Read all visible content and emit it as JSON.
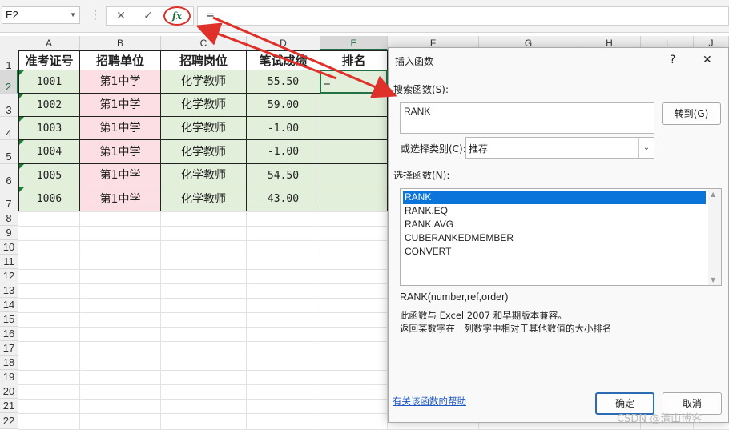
{
  "formula_bar": {
    "name_box": "E2",
    "separator": "⋮",
    "cancel_glyph": "✕",
    "enter_glyph": "✓",
    "fx_label": "fx",
    "formula": "="
  },
  "sheet": {
    "columns": [
      "A",
      "B",
      "C",
      "D",
      "E",
      "F",
      "G",
      "H",
      "I",
      "J"
    ],
    "rows": [
      "1",
      "2",
      "3",
      "4",
      "5",
      "6",
      "7",
      "8",
      "9",
      "10",
      "11",
      "12",
      "13",
      "14",
      "15",
      "16",
      "17",
      "18",
      "19",
      "20",
      "21",
      "22"
    ],
    "headers": [
      "准考证号",
      "招聘单位",
      "招聘岗位",
      "笔试成绩",
      "排名"
    ],
    "data": [
      [
        "1001",
        "第1中学",
        "化学教师",
        "55.50",
        ""
      ],
      [
        "1002",
        "第1中学",
        "化学教师",
        "59.00",
        ""
      ],
      [
        "1003",
        "第1中学",
        "化学教师",
        "-1.00",
        ""
      ],
      [
        "1004",
        "第1中学",
        "化学教师",
        "-1.00",
        ""
      ],
      [
        "1005",
        "第1中学",
        "化学教师",
        "54.50",
        ""
      ],
      [
        "1006",
        "第1中学",
        "化学教师",
        "43.00",
        ""
      ]
    ],
    "active_cell_text": "=",
    "colors": {
      "green": "#e2efda",
      "pink": "#fcdfe4",
      "accent": "#217346"
    }
  },
  "dialog": {
    "title": "插入函数",
    "help_glyph": "?",
    "close_glyph": "✕",
    "search_label": "搜索函数(S):",
    "search_value": "RANK",
    "goto_button": "转到(G)",
    "category_label": "或选择类别(C):",
    "category_value": "推荐",
    "select_label": "选择函数(N):",
    "functions": [
      "RANK",
      "RANK.EQ",
      "RANK.AVG",
      "CUBERANKEDMEMBER",
      "CONVERT"
    ],
    "selected_function": "RANK",
    "signature": "RANK(number,ref,order)",
    "description_1": "此函数与 Excel 2007 和早期版本兼容。",
    "description_2": "返回某数字在一列数字中相对于其他数值的大小排名",
    "help_link": "有关该函数的帮助",
    "ok_button": "确定",
    "cancel_button": "取消"
  },
  "watermark": "CSDN @清山博客"
}
